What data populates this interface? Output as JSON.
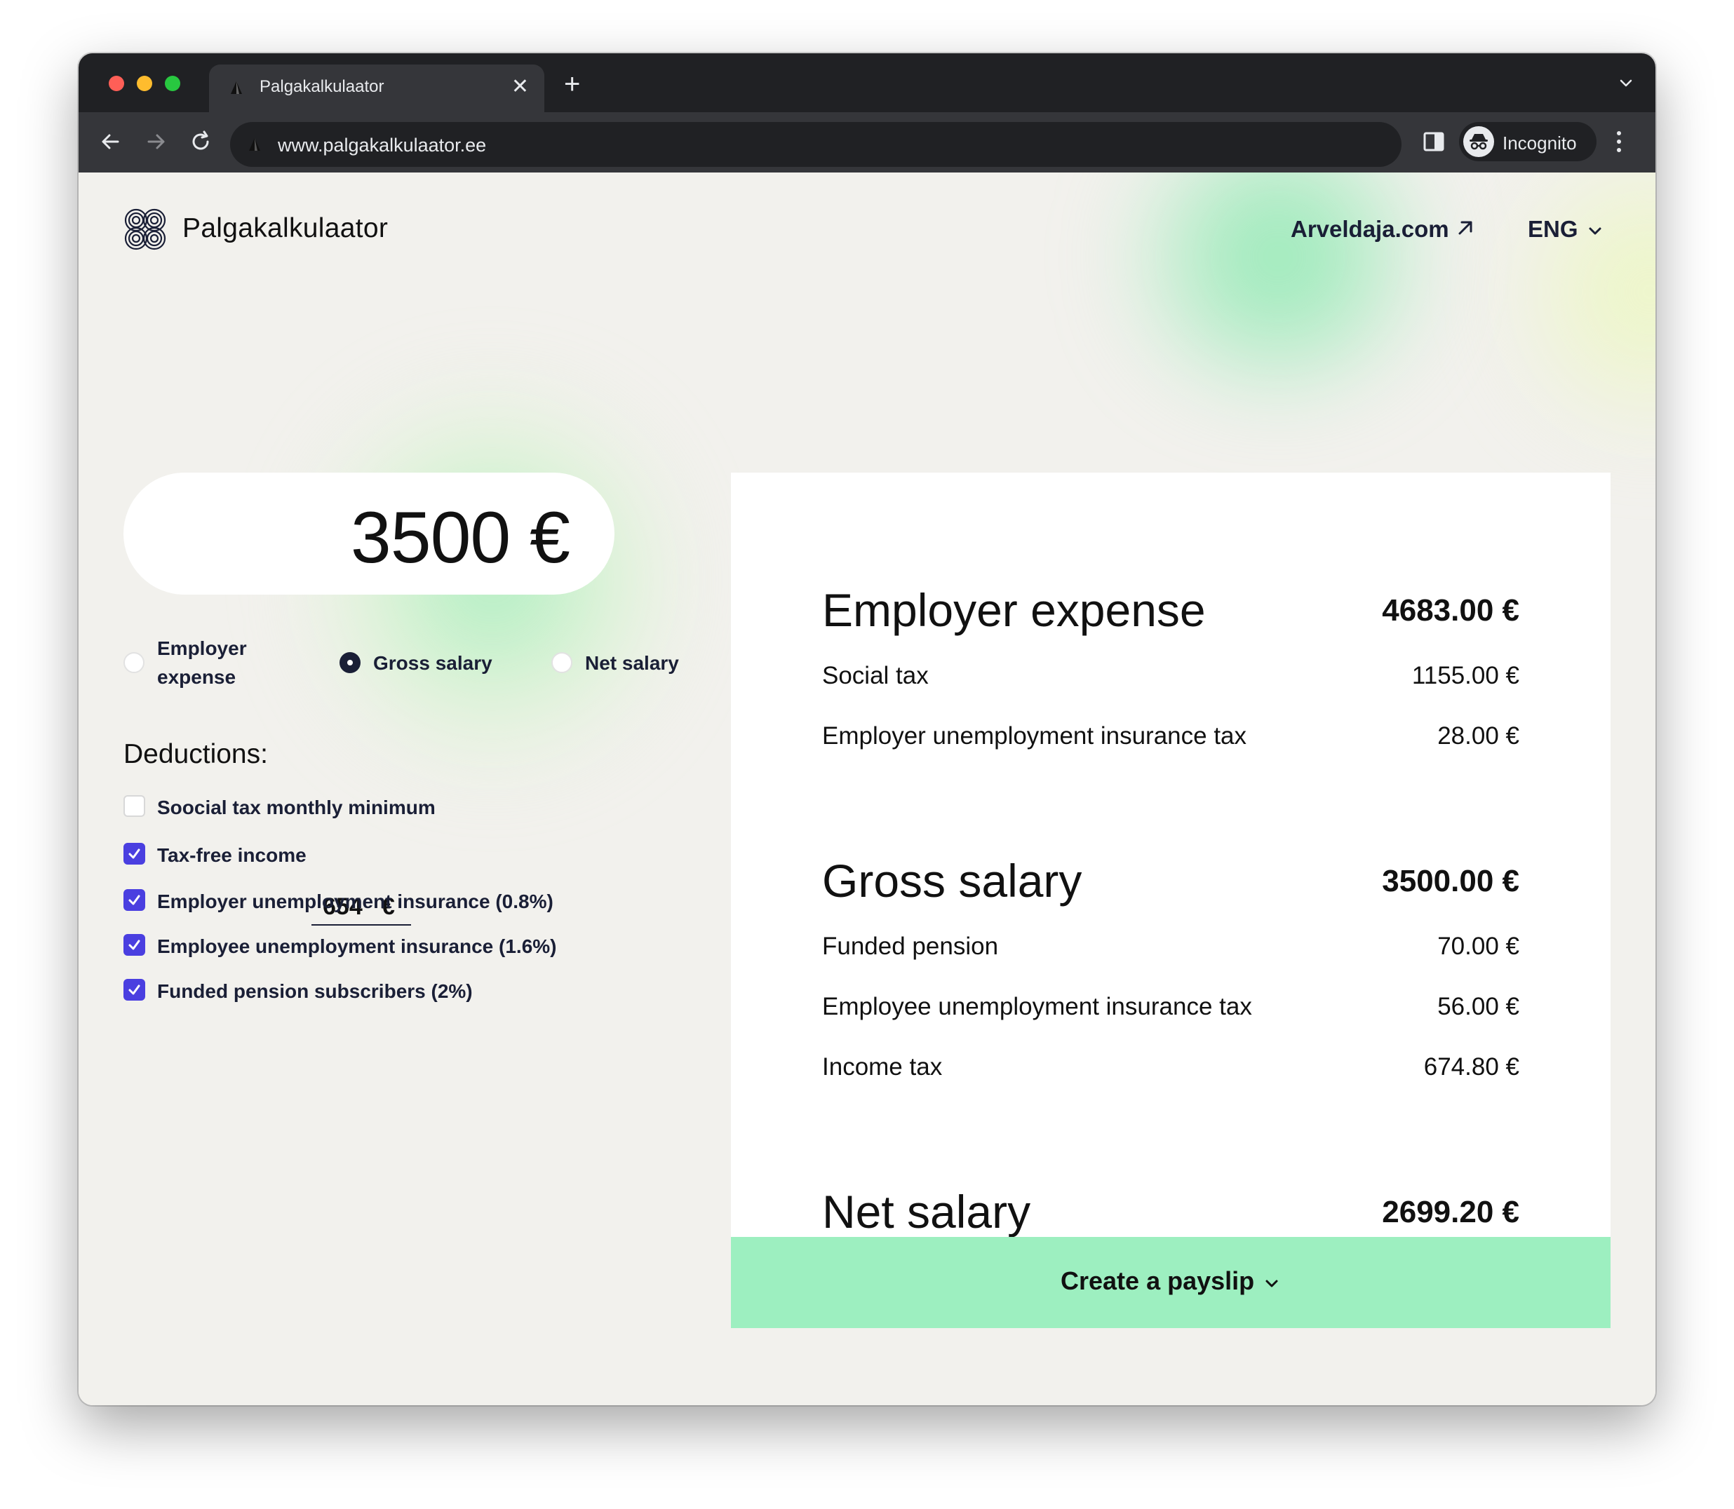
{
  "browser": {
    "tab_title": "Palgakalkulaator",
    "url": "www.palgakalkulaator.ee",
    "profile_label": "Incognito"
  },
  "header": {
    "brand": "Palgakalkulaator",
    "external_link": "Arveldaja.com",
    "language": "ENG"
  },
  "input": {
    "amount": "3500 €",
    "modes": [
      {
        "label": "Employer expense",
        "selected": false
      },
      {
        "label": "Gross salary",
        "selected": true
      },
      {
        "label": "Net salary",
        "selected": false
      }
    ]
  },
  "deductions": {
    "title": "Deductions:",
    "items": [
      {
        "label": "Soocial tax monthly minimum",
        "checked": false
      },
      {
        "label": "Tax-free income",
        "checked": true
      },
      {
        "label": "Employer unemployment insurance (0.8%)",
        "checked": true
      },
      {
        "label": "Employee unemployment insurance (1.6%)",
        "checked": true
      },
      {
        "label": "Funded pension subscribers (2%)",
        "checked": true
      }
    ],
    "tax_free_value": "654",
    "tax_free_unit": "€"
  },
  "results": {
    "employer_expense": {
      "title": "Employer expense",
      "value": "4683.00 €",
      "rows": [
        {
          "label": "Social tax",
          "value": "1155.00 €"
        },
        {
          "label": "Employer unemployment insurance tax",
          "value": "28.00 €"
        }
      ]
    },
    "gross_salary": {
      "title": "Gross salary",
      "value": "3500.00 €",
      "rows": [
        {
          "label": "Funded pension",
          "value": "70.00 €"
        },
        {
          "label": "Employee unemployment insurance tax",
          "value": "56.00 €"
        },
        {
          "label": "Income tax",
          "value": "674.80 €"
        }
      ]
    },
    "net_salary": {
      "title": "Net salary",
      "value": "2699.20 €"
    },
    "payslip_button": "Create a payslip"
  },
  "colors": {
    "page_background": "#f2f1ed",
    "accent_green": "#9defc0",
    "checkbox_purple": "#4a3fe0",
    "text_dark": "#1a1f36"
  }
}
